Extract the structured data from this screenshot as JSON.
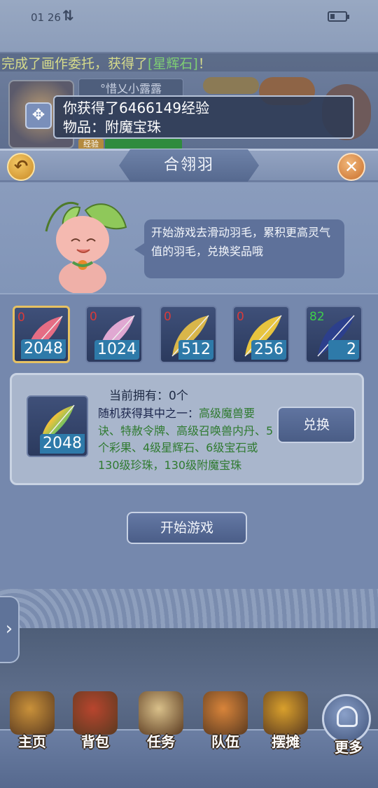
{
  "status_bar": {
    "time": "01 26"
  },
  "chat": {
    "message_prefix": "完成了画作委托，获得了",
    "item": "[星辉石]",
    "message_suffix": "！"
  },
  "player": {
    "name": "°惜乂小露露",
    "exp_label": "经验"
  },
  "toast": {
    "line1": "你获得了6466149经验",
    "line2": "物品：附魔宝珠"
  },
  "dialog": {
    "title": "合翎羽",
    "intro": "开始游戏去滑动羽毛，累积更高灵气值的羽毛，兑换奖品哦"
  },
  "feathers": [
    {
      "count": "0",
      "value": "2048",
      "color": "#e56d84",
      "selected": true
    },
    {
      "count": "0",
      "value": "1024",
      "color": "#e0a8d2",
      "selected": false
    },
    {
      "count": "0",
      "value": "512",
      "color": "#d9b64a",
      "selected": false
    },
    {
      "count": "0",
      "value": "256",
      "color": "#e8c43f",
      "selected": false
    },
    {
      "count": "82",
      "value": "2",
      "color": "#2c3f8c",
      "selected": false
    }
  ],
  "exchange": {
    "owned_label": "当前拥有：0个",
    "reward_value": "2048",
    "reward_prefix": "随机获得其中之一：",
    "reward_list": "高级魔兽要诀、特赦令牌、高级召唤兽内丹、5个彩果、4级星辉石、6级宝石或130级珍珠，130级附魔宝珠",
    "button_label": "兑换"
  },
  "start_button": "开始游戏",
  "bottom_menu": [
    {
      "label": "主页",
      "icon": "house-icon"
    },
    {
      "label": "背包",
      "icon": "chest-icon"
    },
    {
      "label": "任务",
      "icon": "scroll-icon"
    },
    {
      "label": "队伍",
      "icon": "team-icon"
    },
    {
      "label": "摆摊",
      "icon": "coin-icon"
    },
    {
      "label": "更多",
      "icon": "more-icon"
    }
  ],
  "colors": {
    "count_zero": "#d93a3a",
    "count_positive": "#3fcf4a",
    "value_badge": "#2e7aa9",
    "reward_green": "#2f7a30"
  }
}
